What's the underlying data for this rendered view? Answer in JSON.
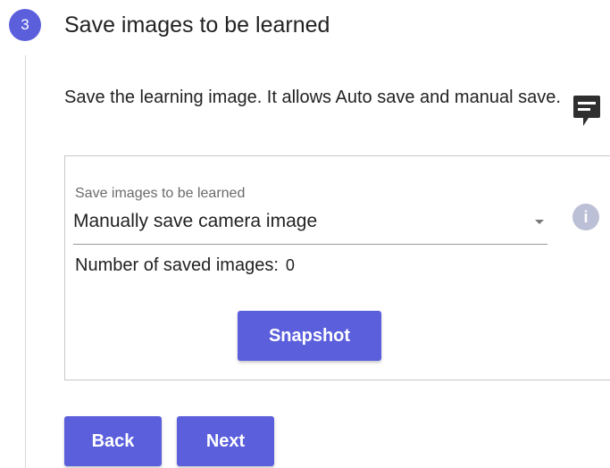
{
  "step": {
    "number": "3",
    "title": "Save images to be learned"
  },
  "description": "Save the learning image. It allows Auto save and manual save.",
  "settings": {
    "select_label": "Save images to be learned",
    "select_value": "Manually save camera image",
    "saved_count_label": "Number of saved images:",
    "saved_count_value": "0",
    "snapshot_label": "Snapshot"
  },
  "icons": {
    "feedback": "comment-icon",
    "info": "info-icon",
    "dropdown": "chevron-down-icon"
  },
  "navigation": {
    "back_label": "Back",
    "next_label": "Next"
  },
  "colors": {
    "accent": "#5b5fdc",
    "info_icon": "#bcc0d6",
    "feedback_icon": "#2f2f2f",
    "text": "#222222",
    "label_text": "#6b6b6b"
  }
}
